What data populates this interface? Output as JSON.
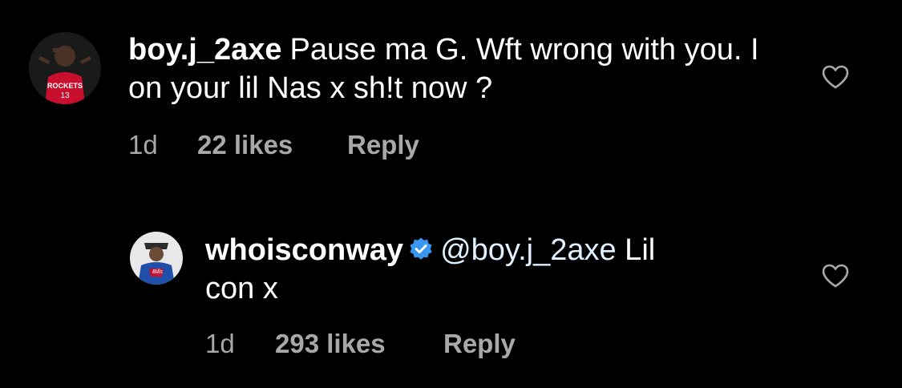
{
  "comments": [
    {
      "username": "boy.j_2axe",
      "text": "Pause ma G. Wft wrong with you. I on your lil Nas x sh!t now ?",
      "time": "1d",
      "likes": "22 likes",
      "reply_label": "Reply",
      "verified": false,
      "avatar_icon": "avatar-player-rockets-jersey"
    },
    {
      "username": "whoisconway",
      "mention": "@boy.j_2axe",
      "text_line1": " Lil",
      "text_line2": "con x",
      "time": "1d",
      "likes": "293 likes",
      "reply_label": "Reply",
      "verified": true,
      "verified_color": "#3897f0",
      "avatar_icon": "avatar-man-bills-jacket"
    }
  ],
  "colors": {
    "background": "#000000",
    "text": "#ffffff",
    "meta": "#a8a8a8",
    "mention": "#e0f1ff"
  }
}
